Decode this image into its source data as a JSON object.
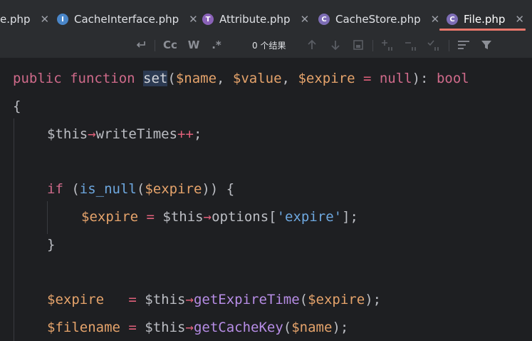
{
  "tabs": [
    {
      "label": "e.php",
      "icon": "php-file-icon",
      "icon_letter": "",
      "active": false
    },
    {
      "label": "CacheInterface.php",
      "icon": "interface-icon",
      "icon_letter": "I",
      "active": false
    },
    {
      "label": "Attribute.php",
      "icon": "trait-icon",
      "icon_letter": "T",
      "active": false
    },
    {
      "label": "CacheStore.php",
      "icon": "class-icon",
      "icon_letter": "C",
      "active": false
    },
    {
      "label": "File.php",
      "icon": "class-icon",
      "icon_letter": "C",
      "active": true
    }
  ],
  "colors": {
    "interface": "#4a86c8",
    "trait": "#8a62b8",
    "class": "#7d6db5",
    "active_underline": "#e8776b"
  },
  "findbar": {
    "regex_toggle_icon": "regex-icon",
    "match_case_label": "Cc",
    "words_label": "W",
    "regex_label": ".*",
    "results_text": "0 个结果"
  },
  "code": {
    "l1": {
      "a": "public ",
      "b": "function ",
      "c": "set",
      "d": "(",
      "e": "$name",
      "f": ", ",
      "g": "$value",
      "h": ", ",
      "i": "$expire",
      "j": " = ",
      "k": "null",
      "l": "): ",
      "m": "bool"
    },
    "l2": {
      "a": "{"
    },
    "l3": {
      "a": "$this",
      "b": "→",
      "c": "writeTimes",
      "d": "++",
      "e": ";"
    },
    "l4": {
      "a": "if",
      "b": " (",
      "c": "is_null",
      "d": "(",
      "e": "$expire",
      "f": ")) {"
    },
    "l5": {
      "a": "$expire",
      "b": " = ",
      "c": "$this",
      "d": "→",
      "e": "options",
      "f": "[",
      "g": "'expire'",
      "h": "];"
    },
    "l6": {
      "a": "}"
    },
    "l7": {
      "a": "$expire",
      "b": "   = ",
      "c": "$this",
      "d": "→",
      "e": "getExpireTime",
      "f": "(",
      "g": "$expire",
      "h": ");"
    },
    "l8": {
      "a": "$filename",
      "b": " = ",
      "c": "$this",
      "d": "→",
      "e": "getCacheKey",
      "f": "(",
      "g": "$name",
      "h": ");"
    }
  }
}
